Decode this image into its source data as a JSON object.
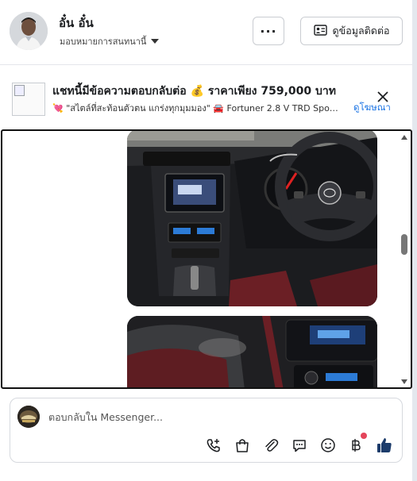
{
  "header": {
    "user_name": "อั๋น อั๋น",
    "assign_label": "มอบหมายการสนทนานี้",
    "more_label": "···",
    "contact_label": "ดูข้อมูลติดต่อ"
  },
  "ad": {
    "title": "แชทนี้มีข้อความตอบกลับต่อ 💰 ราคาเพียง 759,000 บาท",
    "subtitle": "💘 \"สไตล์ที่สะท้อนตัวตน แกร่งทุกมุมมอง\" 🚘 Fortuner 2.8 V TRD Spo…",
    "link_label": "ดูโฆษณา"
  },
  "composer": {
    "placeholder": "ตอบกลับใน Messenger..."
  },
  "icons": {
    "close": "close-icon",
    "contact": "contact-card-icon",
    "call": "add-call-icon",
    "shop": "shopping-bag-icon",
    "attach": "paperclip-icon",
    "reply": "chat-bubble-icon",
    "emoji": "emoji-icon",
    "payment": "baht-icon",
    "like": "thumbs-up-icon"
  },
  "colors": {
    "accent": "#1b74e4",
    "badge": "#e4445a",
    "like": "#1c3c6b"
  }
}
